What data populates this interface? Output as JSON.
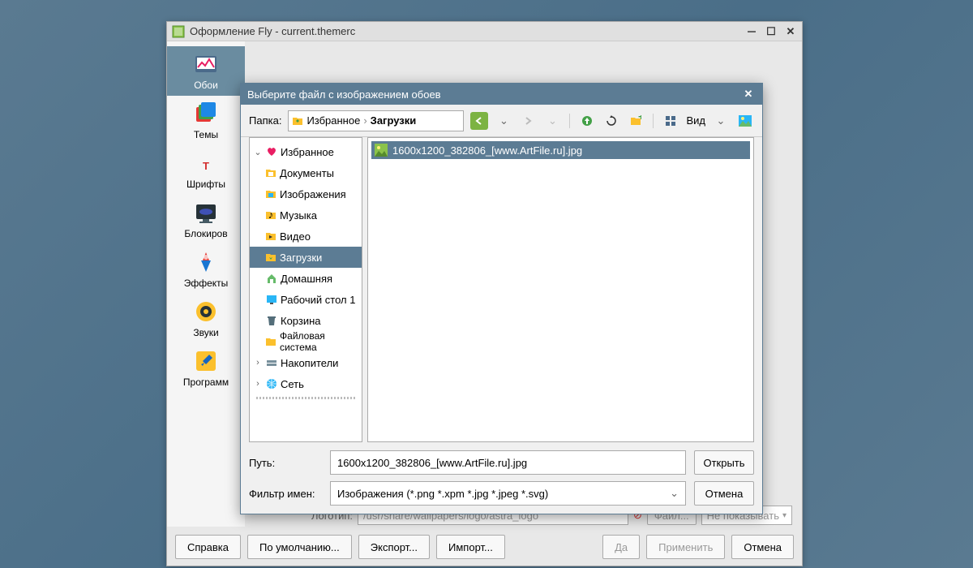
{
  "main_window": {
    "title": "Оформление Fly - current.themerc"
  },
  "sidebar": {
    "items": [
      {
        "label": "Обои"
      },
      {
        "label": "Темы"
      },
      {
        "label": "Шрифты"
      },
      {
        "label": "Блокиров"
      },
      {
        "label": "Эффекты"
      },
      {
        "label": "Звуки"
      },
      {
        "label": "Программ"
      }
    ]
  },
  "partial": {
    "label": "Логотип:",
    "path": "/usr/share/wallpapers/logo/astra_logo",
    "file_btn": "Файл...",
    "show": "Не показывать"
  },
  "footer": {
    "help": "Справка",
    "default": "По умолчанию...",
    "export": "Экспорт...",
    "import": "Импорт...",
    "yes": "Да",
    "apply": "Применить",
    "cancel": "Отмена"
  },
  "dialog": {
    "title": "Выберите файл с изображением обоев",
    "folder_label": "Папка:",
    "breadcrumb": {
      "root": "Избранное",
      "current": "Загрузки"
    },
    "view_label": "Вид",
    "tree": {
      "favorites": "Избранное",
      "documents": "Документы",
      "images": "Изображения",
      "music": "Музыка",
      "video": "Видео",
      "downloads": "Загрузки",
      "home": "Домашняя",
      "desktop": "Рабочий стол 1",
      "trash": "Корзина",
      "filesystem": "Файловая система",
      "drives": "Накопители",
      "network": "Сеть"
    },
    "files": [
      {
        "name": "1600x1200_382806_[www.ArtFile.ru].jpg"
      }
    ],
    "path_label": "Путь:",
    "path_value": "1600x1200_382806_[www.ArtFile.ru].jpg",
    "filter_label": "Фильтр имен:",
    "filter_value": "Изображения (*.png *.xpm *.jpg *.jpeg *.svg)",
    "open": "Открыть",
    "cancel": "Отмена"
  }
}
